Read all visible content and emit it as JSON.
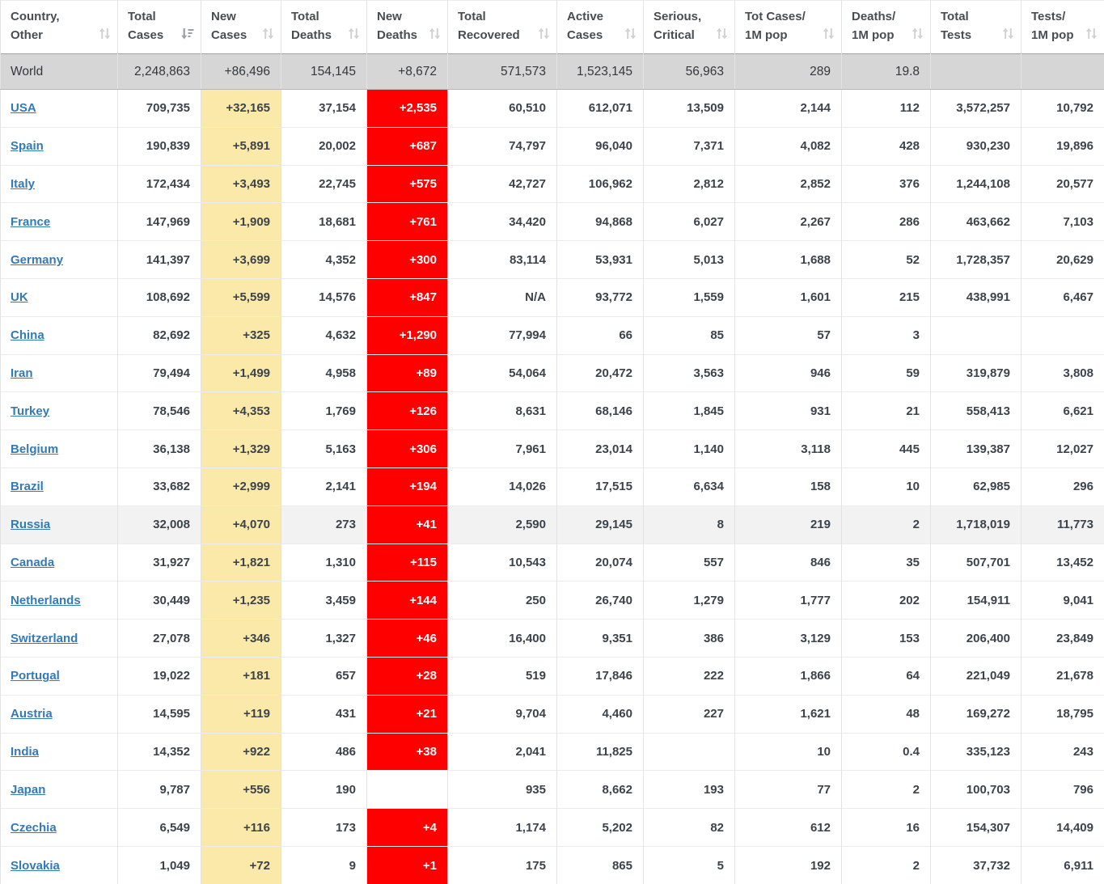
{
  "table": {
    "columns": [
      {
        "key": "country",
        "name": "country-other",
        "line1": "Country,",
        "line2": "Other",
        "sort": "both"
      },
      {
        "key": "total_cases",
        "name": "total-cases",
        "line1": "Total",
        "line2": "Cases",
        "sort": "desc"
      },
      {
        "key": "new_cases",
        "name": "new-cases",
        "line1": "New",
        "line2": "Cases",
        "sort": "both"
      },
      {
        "key": "total_deaths",
        "name": "total-deaths",
        "line1": "Total",
        "line2": "Deaths",
        "sort": "both"
      },
      {
        "key": "new_deaths",
        "name": "new-deaths",
        "line1": "New",
        "line2": "Deaths",
        "sort": "both"
      },
      {
        "key": "total_recovered",
        "name": "total-recovered",
        "line1": "Total",
        "line2": "Recovered",
        "sort": "both"
      },
      {
        "key": "active_cases",
        "name": "active-cases",
        "line1": "Active",
        "line2": "Cases",
        "sort": "both"
      },
      {
        "key": "serious_critical",
        "name": "serious-critical",
        "line1": "Serious,",
        "line2": "Critical",
        "sort": "both"
      },
      {
        "key": "tot_cases_1m",
        "name": "tot-cases-1m-pop",
        "line1": "Tot Cases/",
        "line2": "1M pop",
        "sort": "both"
      },
      {
        "key": "deaths_1m",
        "name": "deaths-1m-pop",
        "line1": "Deaths/",
        "line2": "1M pop",
        "sort": "both"
      },
      {
        "key": "total_tests",
        "name": "total-tests",
        "line1": "Total",
        "line2": "Tests",
        "sort": "both"
      },
      {
        "key": "tests_1m",
        "name": "tests-1m-pop",
        "line1": "Tests/",
        "line2": "1M pop",
        "sort": "both"
      }
    ],
    "world_row": {
      "country": "World",
      "total_cases": "2,248,863",
      "new_cases": "+86,496",
      "total_deaths": "154,145",
      "new_deaths": "+8,672",
      "total_recovered": "571,573",
      "active_cases": "1,523,145",
      "serious_critical": "56,963",
      "tot_cases_1m": "289",
      "deaths_1m": "19.8",
      "total_tests": "",
      "tests_1m": ""
    },
    "rows": [
      {
        "country": "USA",
        "total_cases": "709,735",
        "new_cases": "+32,165",
        "total_deaths": "37,154",
        "new_deaths": "+2,535",
        "total_recovered": "60,510",
        "active_cases": "612,071",
        "serious_critical": "13,509",
        "tot_cases_1m": "2,144",
        "deaths_1m": "112",
        "total_tests": "3,572,257",
        "tests_1m": "10,792",
        "highlighted": false
      },
      {
        "country": "Spain",
        "total_cases": "190,839",
        "new_cases": "+5,891",
        "total_deaths": "20,002",
        "new_deaths": "+687",
        "total_recovered": "74,797",
        "active_cases": "96,040",
        "serious_critical": "7,371",
        "tot_cases_1m": "4,082",
        "deaths_1m": "428",
        "total_tests": "930,230",
        "tests_1m": "19,896",
        "highlighted": false
      },
      {
        "country": "Italy",
        "total_cases": "172,434",
        "new_cases": "+3,493",
        "total_deaths": "22,745",
        "new_deaths": "+575",
        "total_recovered": "42,727",
        "active_cases": "106,962",
        "serious_critical": "2,812",
        "tot_cases_1m": "2,852",
        "deaths_1m": "376",
        "total_tests": "1,244,108",
        "tests_1m": "20,577",
        "highlighted": false
      },
      {
        "country": "France",
        "total_cases": "147,969",
        "new_cases": "+1,909",
        "total_deaths": "18,681",
        "new_deaths": "+761",
        "total_recovered": "34,420",
        "active_cases": "94,868",
        "serious_critical": "6,027",
        "tot_cases_1m": "2,267",
        "deaths_1m": "286",
        "total_tests": "463,662",
        "tests_1m": "7,103",
        "highlighted": false
      },
      {
        "country": "Germany",
        "total_cases": "141,397",
        "new_cases": "+3,699",
        "total_deaths": "4,352",
        "new_deaths": "+300",
        "total_recovered": "83,114",
        "active_cases": "53,931",
        "serious_critical": "5,013",
        "tot_cases_1m": "1,688",
        "deaths_1m": "52",
        "total_tests": "1,728,357",
        "tests_1m": "20,629",
        "highlighted": false
      },
      {
        "country": "UK",
        "total_cases": "108,692",
        "new_cases": "+5,599",
        "total_deaths": "14,576",
        "new_deaths": "+847",
        "total_recovered": "N/A",
        "active_cases": "93,772",
        "serious_critical": "1,559",
        "tot_cases_1m": "1,601",
        "deaths_1m": "215",
        "total_tests": "438,991",
        "tests_1m": "6,467",
        "highlighted": false
      },
      {
        "country": "China",
        "total_cases": "82,692",
        "new_cases": "+325",
        "total_deaths": "4,632",
        "new_deaths": "+1,290",
        "total_recovered": "77,994",
        "active_cases": "66",
        "serious_critical": "85",
        "tot_cases_1m": "57",
        "deaths_1m": "3",
        "total_tests": "",
        "tests_1m": "",
        "highlighted": false
      },
      {
        "country": "Iran",
        "total_cases": "79,494",
        "new_cases": "+1,499",
        "total_deaths": "4,958",
        "new_deaths": "+89",
        "total_recovered": "54,064",
        "active_cases": "20,472",
        "serious_critical": "3,563",
        "tot_cases_1m": "946",
        "deaths_1m": "59",
        "total_tests": "319,879",
        "tests_1m": "3,808",
        "highlighted": false
      },
      {
        "country": "Turkey",
        "total_cases": "78,546",
        "new_cases": "+4,353",
        "total_deaths": "1,769",
        "new_deaths": "+126",
        "total_recovered": "8,631",
        "active_cases": "68,146",
        "serious_critical": "1,845",
        "tot_cases_1m": "931",
        "deaths_1m": "21",
        "total_tests": "558,413",
        "tests_1m": "6,621",
        "highlighted": false
      },
      {
        "country": "Belgium",
        "total_cases": "36,138",
        "new_cases": "+1,329",
        "total_deaths": "5,163",
        "new_deaths": "+306",
        "total_recovered": "7,961",
        "active_cases": "23,014",
        "serious_critical": "1,140",
        "tot_cases_1m": "3,118",
        "deaths_1m": "445",
        "total_tests": "139,387",
        "tests_1m": "12,027",
        "highlighted": false
      },
      {
        "country": "Brazil",
        "total_cases": "33,682",
        "new_cases": "+2,999",
        "total_deaths": "2,141",
        "new_deaths": "+194",
        "total_recovered": "14,026",
        "active_cases": "17,515",
        "serious_critical": "6,634",
        "tot_cases_1m": "158",
        "deaths_1m": "10",
        "total_tests": "62,985",
        "tests_1m": "296",
        "highlighted": false
      },
      {
        "country": "Russia",
        "total_cases": "32,008",
        "new_cases": "+4,070",
        "total_deaths": "273",
        "new_deaths": "+41",
        "total_recovered": "2,590",
        "active_cases": "29,145",
        "serious_critical": "8",
        "tot_cases_1m": "219",
        "deaths_1m": "2",
        "total_tests": "1,718,019",
        "tests_1m": "11,773",
        "highlighted": true
      },
      {
        "country": "Canada",
        "total_cases": "31,927",
        "new_cases": "+1,821",
        "total_deaths": "1,310",
        "new_deaths": "+115",
        "total_recovered": "10,543",
        "active_cases": "20,074",
        "serious_critical": "557",
        "tot_cases_1m": "846",
        "deaths_1m": "35",
        "total_tests": "507,701",
        "tests_1m": "13,452",
        "highlighted": false
      },
      {
        "country": "Netherlands",
        "total_cases": "30,449",
        "new_cases": "+1,235",
        "total_deaths": "3,459",
        "new_deaths": "+144",
        "total_recovered": "250",
        "active_cases": "26,740",
        "serious_critical": "1,279",
        "tot_cases_1m": "1,777",
        "deaths_1m": "202",
        "total_tests": "154,911",
        "tests_1m": "9,041",
        "highlighted": false
      },
      {
        "country": "Switzerland",
        "total_cases": "27,078",
        "new_cases": "+346",
        "total_deaths": "1,327",
        "new_deaths": "+46",
        "total_recovered": "16,400",
        "active_cases": "9,351",
        "serious_critical": "386",
        "tot_cases_1m": "3,129",
        "deaths_1m": "153",
        "total_tests": "206,400",
        "tests_1m": "23,849",
        "highlighted": false
      },
      {
        "country": "Portugal",
        "total_cases": "19,022",
        "new_cases": "+181",
        "total_deaths": "657",
        "new_deaths": "+28",
        "total_recovered": "519",
        "active_cases": "17,846",
        "serious_critical": "222",
        "tot_cases_1m": "1,866",
        "deaths_1m": "64",
        "total_tests": "221,049",
        "tests_1m": "21,678",
        "highlighted": false
      },
      {
        "country": "Austria",
        "total_cases": "14,595",
        "new_cases": "+119",
        "total_deaths": "431",
        "new_deaths": "+21",
        "total_recovered": "9,704",
        "active_cases": "4,460",
        "serious_critical": "227",
        "tot_cases_1m": "1,621",
        "deaths_1m": "48",
        "total_tests": "169,272",
        "tests_1m": "18,795",
        "highlighted": false
      },
      {
        "country": "India",
        "total_cases": "14,352",
        "new_cases": "+922",
        "total_deaths": "486",
        "new_deaths": "+38",
        "total_recovered": "2,041",
        "active_cases": "11,825",
        "serious_critical": "",
        "tot_cases_1m": "10",
        "deaths_1m": "0.4",
        "total_tests": "335,123",
        "tests_1m": "243",
        "highlighted": false
      },
      {
        "country": "Japan",
        "total_cases": "9,787",
        "new_cases": "+556",
        "total_deaths": "190",
        "new_deaths": "",
        "total_recovered": "935",
        "active_cases": "8,662",
        "serious_critical": "193",
        "tot_cases_1m": "77",
        "deaths_1m": "2",
        "total_tests": "100,703",
        "tests_1m": "796",
        "highlighted": false
      },
      {
        "country": "Czechia",
        "total_cases": "6,549",
        "new_cases": "+116",
        "total_deaths": "173",
        "new_deaths": "+4",
        "total_recovered": "1,174",
        "active_cases": "5,202",
        "serious_critical": "82",
        "tot_cases_1m": "612",
        "deaths_1m": "16",
        "total_tests": "154,307",
        "tests_1m": "14,409",
        "highlighted": false
      },
      {
        "country": "Slovakia",
        "total_cases": "1,049",
        "new_cases": "+72",
        "total_deaths": "9",
        "new_deaths": "+1",
        "total_recovered": "175",
        "active_cases": "865",
        "serious_critical": "5",
        "tot_cases_1m": "192",
        "deaths_1m": "2",
        "total_tests": "37,732",
        "tests_1m": "6,911",
        "highlighted": false
      }
    ]
  },
  "colors": {
    "new_cases_bg": "#fae9a9",
    "new_deaths_bg": "#ff0000",
    "world_row_bg": "#d6d6d6",
    "highlight_row_bg": "#f2f2f2",
    "link_blue": "#337ab7",
    "text_dark": "#3c434b"
  },
  "icons": {
    "sortable": "sort-updown-icon",
    "sorted_desc": "sort-amount-desc-icon"
  }
}
